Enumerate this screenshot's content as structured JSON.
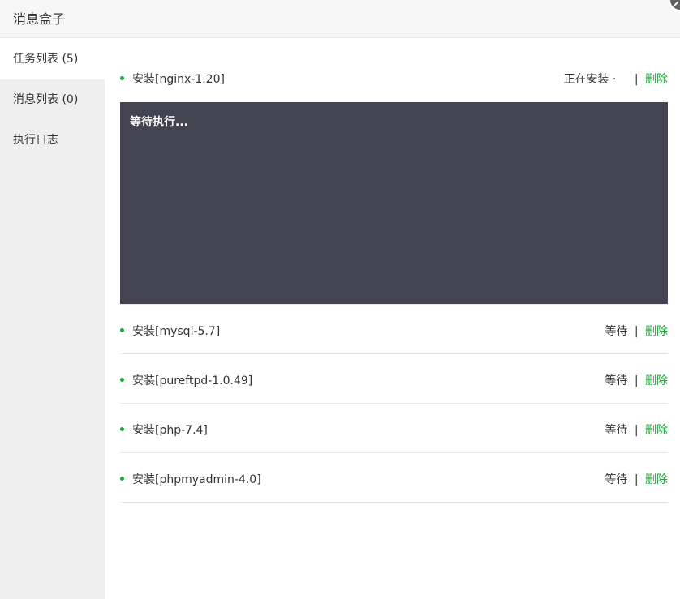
{
  "window": {
    "title": "消息盒子"
  },
  "sidebar": {
    "items": [
      {
        "label": "任务列表 (5)"
      },
      {
        "label": "消息列表 (0)"
      },
      {
        "label": "执行日志"
      }
    ]
  },
  "tasks": [
    {
      "name": "安装[nginx-1.20]",
      "status": "正在安装 ·",
      "action": "删除",
      "separator": "|"
    },
    {
      "name": "安装[mysql-5.7]",
      "status": "等待",
      "action": "删除",
      "separator": "|"
    },
    {
      "name": "安装[pureftpd-1.0.49]",
      "status": "等待",
      "action": "删除",
      "separator": "|"
    },
    {
      "name": "安装[php-7.4]",
      "status": "等待",
      "action": "删除",
      "separator": "|"
    },
    {
      "name": "安装[phpmyadmin-4.0]",
      "status": "等待",
      "action": "删除",
      "separator": "|"
    }
  ],
  "console": {
    "text": "等待执行..."
  },
  "colors": {
    "accent": "#20a53a",
    "console_bg": "#444451",
    "sidebar_bg": "#efefef"
  }
}
